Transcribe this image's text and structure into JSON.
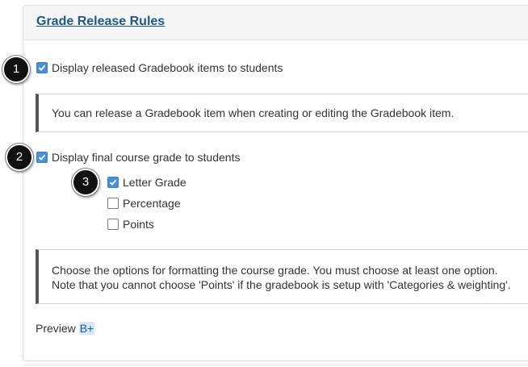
{
  "panel": {
    "title": "Grade Release Rules"
  },
  "options": {
    "released_items": {
      "label": "Display released Gradebook items to students",
      "checked": true
    },
    "final_grade": {
      "label": "Display final course grade to students",
      "checked": true
    }
  },
  "notes": {
    "release_note": "You can release a Gradebook item when creating or editing the Gradebook item.",
    "format_note_line1": "Choose the options for formatting the course grade. You must choose at least one option.",
    "format_note_line2": "Note that you cannot choose 'Points' if the gradebook is setup with 'Categories & weighting'."
  },
  "formats": [
    {
      "label": "Letter Grade",
      "checked": true
    },
    {
      "label": "Percentage",
      "checked": false
    },
    {
      "label": "Points",
      "checked": false
    }
  ],
  "preview": {
    "label": "Preview",
    "value": "B+"
  },
  "markers": [
    "1",
    "2",
    "3"
  ],
  "colors": {
    "accent": "#4a90d9",
    "title_link": "#1d5b86",
    "marker_bg": "#111111"
  }
}
